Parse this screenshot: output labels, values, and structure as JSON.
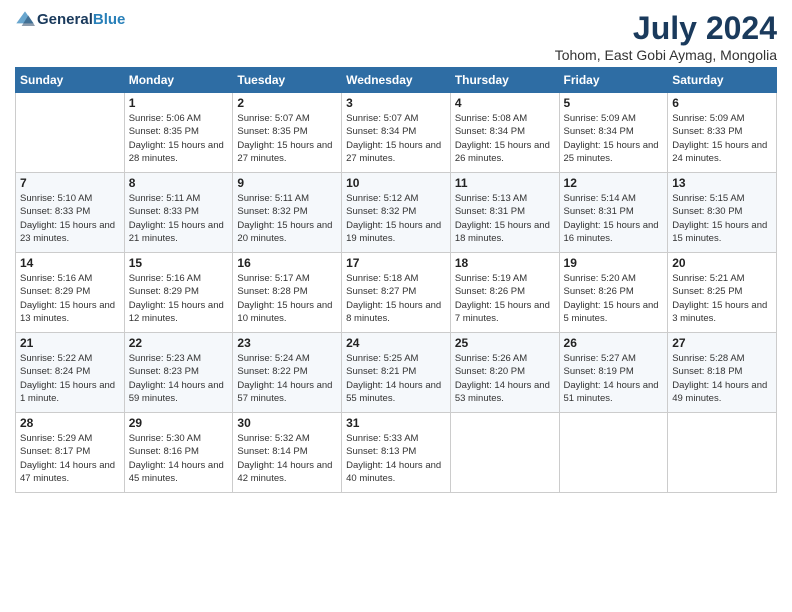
{
  "header": {
    "logo_general": "General",
    "logo_blue": "Blue",
    "month_year": "July 2024",
    "location": "Tohom, East Gobi Aymag, Mongolia"
  },
  "weekdays": [
    "Sunday",
    "Monday",
    "Tuesday",
    "Wednesday",
    "Thursday",
    "Friday",
    "Saturday"
  ],
  "weeks": [
    [
      {
        "day": "",
        "sunrise": "",
        "sunset": "",
        "daylight": ""
      },
      {
        "day": "1",
        "sunrise": "Sunrise: 5:06 AM",
        "sunset": "Sunset: 8:35 PM",
        "daylight": "Daylight: 15 hours and 28 minutes."
      },
      {
        "day": "2",
        "sunrise": "Sunrise: 5:07 AM",
        "sunset": "Sunset: 8:35 PM",
        "daylight": "Daylight: 15 hours and 27 minutes."
      },
      {
        "day": "3",
        "sunrise": "Sunrise: 5:07 AM",
        "sunset": "Sunset: 8:34 PM",
        "daylight": "Daylight: 15 hours and 27 minutes."
      },
      {
        "day": "4",
        "sunrise": "Sunrise: 5:08 AM",
        "sunset": "Sunset: 8:34 PM",
        "daylight": "Daylight: 15 hours and 26 minutes."
      },
      {
        "day": "5",
        "sunrise": "Sunrise: 5:09 AM",
        "sunset": "Sunset: 8:34 PM",
        "daylight": "Daylight: 15 hours and 25 minutes."
      },
      {
        "day": "6",
        "sunrise": "Sunrise: 5:09 AM",
        "sunset": "Sunset: 8:33 PM",
        "daylight": "Daylight: 15 hours and 24 minutes."
      }
    ],
    [
      {
        "day": "7",
        "sunrise": "Sunrise: 5:10 AM",
        "sunset": "Sunset: 8:33 PM",
        "daylight": "Daylight: 15 hours and 23 minutes."
      },
      {
        "day": "8",
        "sunrise": "Sunrise: 5:11 AM",
        "sunset": "Sunset: 8:33 PM",
        "daylight": "Daylight: 15 hours and 21 minutes."
      },
      {
        "day": "9",
        "sunrise": "Sunrise: 5:11 AM",
        "sunset": "Sunset: 8:32 PM",
        "daylight": "Daylight: 15 hours and 20 minutes."
      },
      {
        "day": "10",
        "sunrise": "Sunrise: 5:12 AM",
        "sunset": "Sunset: 8:32 PM",
        "daylight": "Daylight: 15 hours and 19 minutes."
      },
      {
        "day": "11",
        "sunrise": "Sunrise: 5:13 AM",
        "sunset": "Sunset: 8:31 PM",
        "daylight": "Daylight: 15 hours and 18 minutes."
      },
      {
        "day": "12",
        "sunrise": "Sunrise: 5:14 AM",
        "sunset": "Sunset: 8:31 PM",
        "daylight": "Daylight: 15 hours and 16 minutes."
      },
      {
        "day": "13",
        "sunrise": "Sunrise: 5:15 AM",
        "sunset": "Sunset: 8:30 PM",
        "daylight": "Daylight: 15 hours and 15 minutes."
      }
    ],
    [
      {
        "day": "14",
        "sunrise": "Sunrise: 5:16 AM",
        "sunset": "Sunset: 8:29 PM",
        "daylight": "Daylight: 15 hours and 13 minutes."
      },
      {
        "day": "15",
        "sunrise": "Sunrise: 5:16 AM",
        "sunset": "Sunset: 8:29 PM",
        "daylight": "Daylight: 15 hours and 12 minutes."
      },
      {
        "day": "16",
        "sunrise": "Sunrise: 5:17 AM",
        "sunset": "Sunset: 8:28 PM",
        "daylight": "Daylight: 15 hours and 10 minutes."
      },
      {
        "day": "17",
        "sunrise": "Sunrise: 5:18 AM",
        "sunset": "Sunset: 8:27 PM",
        "daylight": "Daylight: 15 hours and 8 minutes."
      },
      {
        "day": "18",
        "sunrise": "Sunrise: 5:19 AM",
        "sunset": "Sunset: 8:26 PM",
        "daylight": "Daylight: 15 hours and 7 minutes."
      },
      {
        "day": "19",
        "sunrise": "Sunrise: 5:20 AM",
        "sunset": "Sunset: 8:26 PM",
        "daylight": "Daylight: 15 hours and 5 minutes."
      },
      {
        "day": "20",
        "sunrise": "Sunrise: 5:21 AM",
        "sunset": "Sunset: 8:25 PM",
        "daylight": "Daylight: 15 hours and 3 minutes."
      }
    ],
    [
      {
        "day": "21",
        "sunrise": "Sunrise: 5:22 AM",
        "sunset": "Sunset: 8:24 PM",
        "daylight": "Daylight: 15 hours and 1 minute."
      },
      {
        "day": "22",
        "sunrise": "Sunrise: 5:23 AM",
        "sunset": "Sunset: 8:23 PM",
        "daylight": "Daylight: 14 hours and 59 minutes."
      },
      {
        "day": "23",
        "sunrise": "Sunrise: 5:24 AM",
        "sunset": "Sunset: 8:22 PM",
        "daylight": "Daylight: 14 hours and 57 minutes."
      },
      {
        "day": "24",
        "sunrise": "Sunrise: 5:25 AM",
        "sunset": "Sunset: 8:21 PM",
        "daylight": "Daylight: 14 hours and 55 minutes."
      },
      {
        "day": "25",
        "sunrise": "Sunrise: 5:26 AM",
        "sunset": "Sunset: 8:20 PM",
        "daylight": "Daylight: 14 hours and 53 minutes."
      },
      {
        "day": "26",
        "sunrise": "Sunrise: 5:27 AM",
        "sunset": "Sunset: 8:19 PM",
        "daylight": "Daylight: 14 hours and 51 minutes."
      },
      {
        "day": "27",
        "sunrise": "Sunrise: 5:28 AM",
        "sunset": "Sunset: 8:18 PM",
        "daylight": "Daylight: 14 hours and 49 minutes."
      }
    ],
    [
      {
        "day": "28",
        "sunrise": "Sunrise: 5:29 AM",
        "sunset": "Sunset: 8:17 PM",
        "daylight": "Daylight: 14 hours and 47 minutes."
      },
      {
        "day": "29",
        "sunrise": "Sunrise: 5:30 AM",
        "sunset": "Sunset: 8:16 PM",
        "daylight": "Daylight: 14 hours and 45 minutes."
      },
      {
        "day": "30",
        "sunrise": "Sunrise: 5:32 AM",
        "sunset": "Sunset: 8:14 PM",
        "daylight": "Daylight: 14 hours and 42 minutes."
      },
      {
        "day": "31",
        "sunrise": "Sunrise: 5:33 AM",
        "sunset": "Sunset: 8:13 PM",
        "daylight": "Daylight: 14 hours and 40 minutes."
      },
      {
        "day": "",
        "sunrise": "",
        "sunset": "",
        "daylight": ""
      },
      {
        "day": "",
        "sunrise": "",
        "sunset": "",
        "daylight": ""
      },
      {
        "day": "",
        "sunrise": "",
        "sunset": "",
        "daylight": ""
      }
    ]
  ]
}
